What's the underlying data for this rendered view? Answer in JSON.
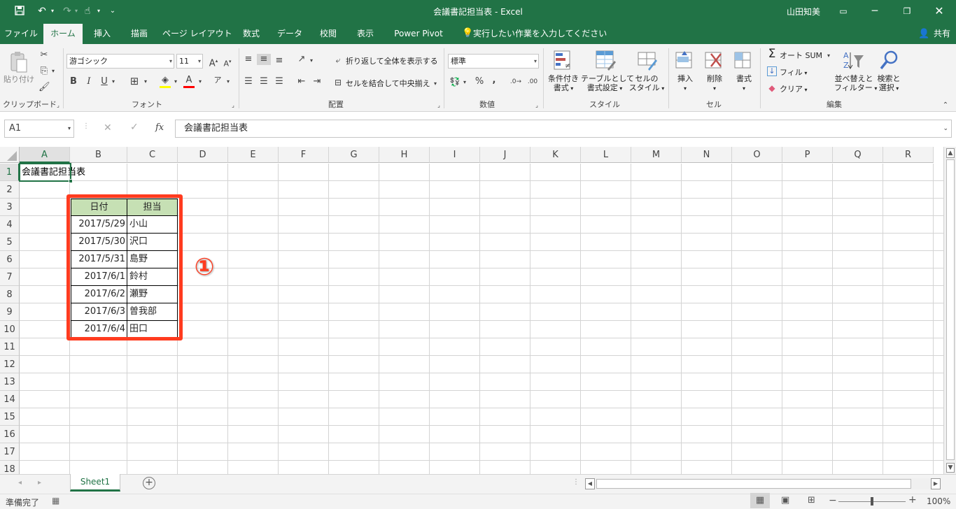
{
  "colors": {
    "brand": "#217346",
    "table_header": "#c6e0b4",
    "highlight": "#ff3b1f",
    "selection": "#217346"
  },
  "titlebar": {
    "doc_title": "会議書記担当表 - Excel",
    "user": "山田知美"
  },
  "qat": {
    "icons": [
      "save-icon",
      "undo-icon",
      "redo-icon",
      "touch-mode-icon",
      "customize-icon"
    ]
  },
  "tabs": [
    "ファイル",
    "ホーム",
    "挿入",
    "描画",
    "ページ レイアウト",
    "数式",
    "データ",
    "校閲",
    "表示",
    "Power Pivot"
  ],
  "tellme": "実行したい作業を入力してください",
  "share": "共有",
  "ribbon": {
    "clipboard": {
      "paste": "貼り付け",
      "label": "クリップボード"
    },
    "font": {
      "name": "游ゴシック",
      "size": "11",
      "bold": "B",
      "italic": "I",
      "underline": "U",
      "label": "フォント"
    },
    "alignment": {
      "wrap": "折り返して全体を表示する",
      "merge": "セルを結合して中央揃え",
      "label": "配置"
    },
    "number": {
      "format": "標準",
      "percent": "%",
      "comma": ",",
      "label": "数値"
    },
    "styles": {
      "cond_line1": "条件付き",
      "cond_line2": "書式",
      "table_line1": "テーブルとして",
      "table_line2": "書式設定",
      "cell_line1": "セルの",
      "cell_line2": "スタイル",
      "label": "スタイル"
    },
    "cells": {
      "insert": "挿入",
      "delete": "削除",
      "format": "書式",
      "label": "セル"
    },
    "editing": {
      "autosum": "オート SUM",
      "fill": "フィル",
      "clear": "クリア",
      "sort_line1": "並べ替えと",
      "sort_line2": "フィルター",
      "find_line1": "検索と",
      "find_line2": "選択",
      "label": "編集"
    }
  },
  "formula_bar": {
    "name_box": "A1",
    "fx": "fx",
    "content": "会議書記担当表"
  },
  "columns": [
    "A",
    "B",
    "C",
    "D",
    "E",
    "F",
    "G",
    "H",
    "I",
    "J",
    "K",
    "L",
    "M",
    "N",
    "O",
    "P",
    "Q",
    "R"
  ],
  "rows": [
    "1",
    "2",
    "3",
    "4",
    "5",
    "6",
    "7",
    "8",
    "9",
    "10",
    "11",
    "12",
    "13",
    "14",
    "15",
    "16",
    "17",
    "18"
  ],
  "sheet": {
    "title": "会議書記担当表",
    "table_header": {
      "date": "日付",
      "person": "担当"
    },
    "entries": [
      {
        "date": "2017/5/29",
        "person": "小山"
      },
      {
        "date": "2017/5/30",
        "person": "沢口"
      },
      {
        "date": "2017/5/31",
        "person": "島野"
      },
      {
        "date": "2017/6/1",
        "person": "鈴村"
      },
      {
        "date": "2017/6/2",
        "person": "瀬野"
      },
      {
        "date": "2017/6/3",
        "person": "曽我部"
      },
      {
        "date": "2017/6/4",
        "person": "田口"
      }
    ],
    "annotation": "①"
  },
  "sheet_tabs": {
    "active": "Sheet1",
    "add": "+"
  },
  "status": {
    "ready": "準備完了",
    "zoom": "100%"
  }
}
